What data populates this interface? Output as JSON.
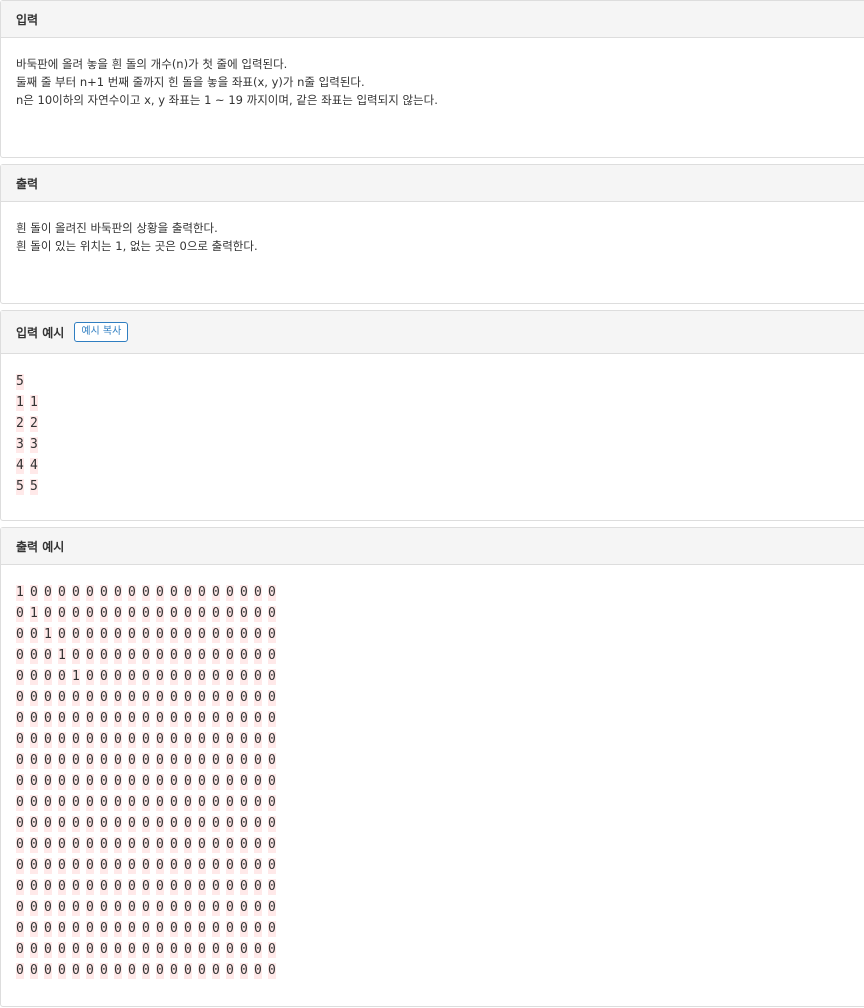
{
  "input_panel": {
    "title": "입력",
    "lines": [
      "바둑판에 올려 놓을 흰 돌의 개수(n)가 첫 줄에 입력된다.",
      "둘째 줄 부터 n+1 번째 줄까지 힌 돌을 놓을 좌표(x, y)가 n줄 입력된다.",
      "n은 10이하의 자연수이고 x, y 좌표는 1 ~ 19 까지이며, 같은 좌표는 입력되지 않는다."
    ]
  },
  "output_panel": {
    "title": "출력",
    "lines": [
      "흰 돌이 올려진 바둑판의 상황을 출력한다.",
      "흰 돌이 있는 위치는 1, 없는 곳은 0으로 출력한다."
    ]
  },
  "input_example": {
    "title": "입력 예시",
    "copy_button": "예시 복사",
    "lines": [
      "5",
      "1 1",
      "2 2",
      "3 3",
      "4 4",
      "5 5"
    ]
  },
  "output_example": {
    "title": "출력 예시",
    "lines": [
      "1 0 0 0 0 0 0 0 0 0 0 0 0 0 0 0 0 0 0",
      "0 1 0 0 0 0 0 0 0 0 0 0 0 0 0 0 0 0 0",
      "0 0 1 0 0 0 0 0 0 0 0 0 0 0 0 0 0 0 0",
      "0 0 0 1 0 0 0 0 0 0 0 0 0 0 0 0 0 0 0",
      "0 0 0 0 1 0 0 0 0 0 0 0 0 0 0 0 0 0 0",
      "0 0 0 0 0 0 0 0 0 0 0 0 0 0 0 0 0 0 0",
      "0 0 0 0 0 0 0 0 0 0 0 0 0 0 0 0 0 0 0",
      "0 0 0 0 0 0 0 0 0 0 0 0 0 0 0 0 0 0 0",
      "0 0 0 0 0 0 0 0 0 0 0 0 0 0 0 0 0 0 0",
      "0 0 0 0 0 0 0 0 0 0 0 0 0 0 0 0 0 0 0",
      "0 0 0 0 0 0 0 0 0 0 0 0 0 0 0 0 0 0 0",
      "0 0 0 0 0 0 0 0 0 0 0 0 0 0 0 0 0 0 0",
      "0 0 0 0 0 0 0 0 0 0 0 0 0 0 0 0 0 0 0",
      "0 0 0 0 0 0 0 0 0 0 0 0 0 0 0 0 0 0 0",
      "0 0 0 0 0 0 0 0 0 0 0 0 0 0 0 0 0 0 0",
      "0 0 0 0 0 0 0 0 0 0 0 0 0 0 0 0 0 0 0",
      "0 0 0 0 0 0 0 0 0 0 0 0 0 0 0 0 0 0 0",
      "0 0 0 0 0 0 0 0 0 0 0 0 0 0 0 0 0 0 0",
      "0 0 0 0 0 0 0 0 0 0 0 0 0 0 0 0 0 0 0"
    ]
  },
  "colors": {
    "heading_bg": "#f5f5f5",
    "border": "#dddddd",
    "accent": "#2f7ec1",
    "sample_highlight": "#ffe9e9"
  }
}
